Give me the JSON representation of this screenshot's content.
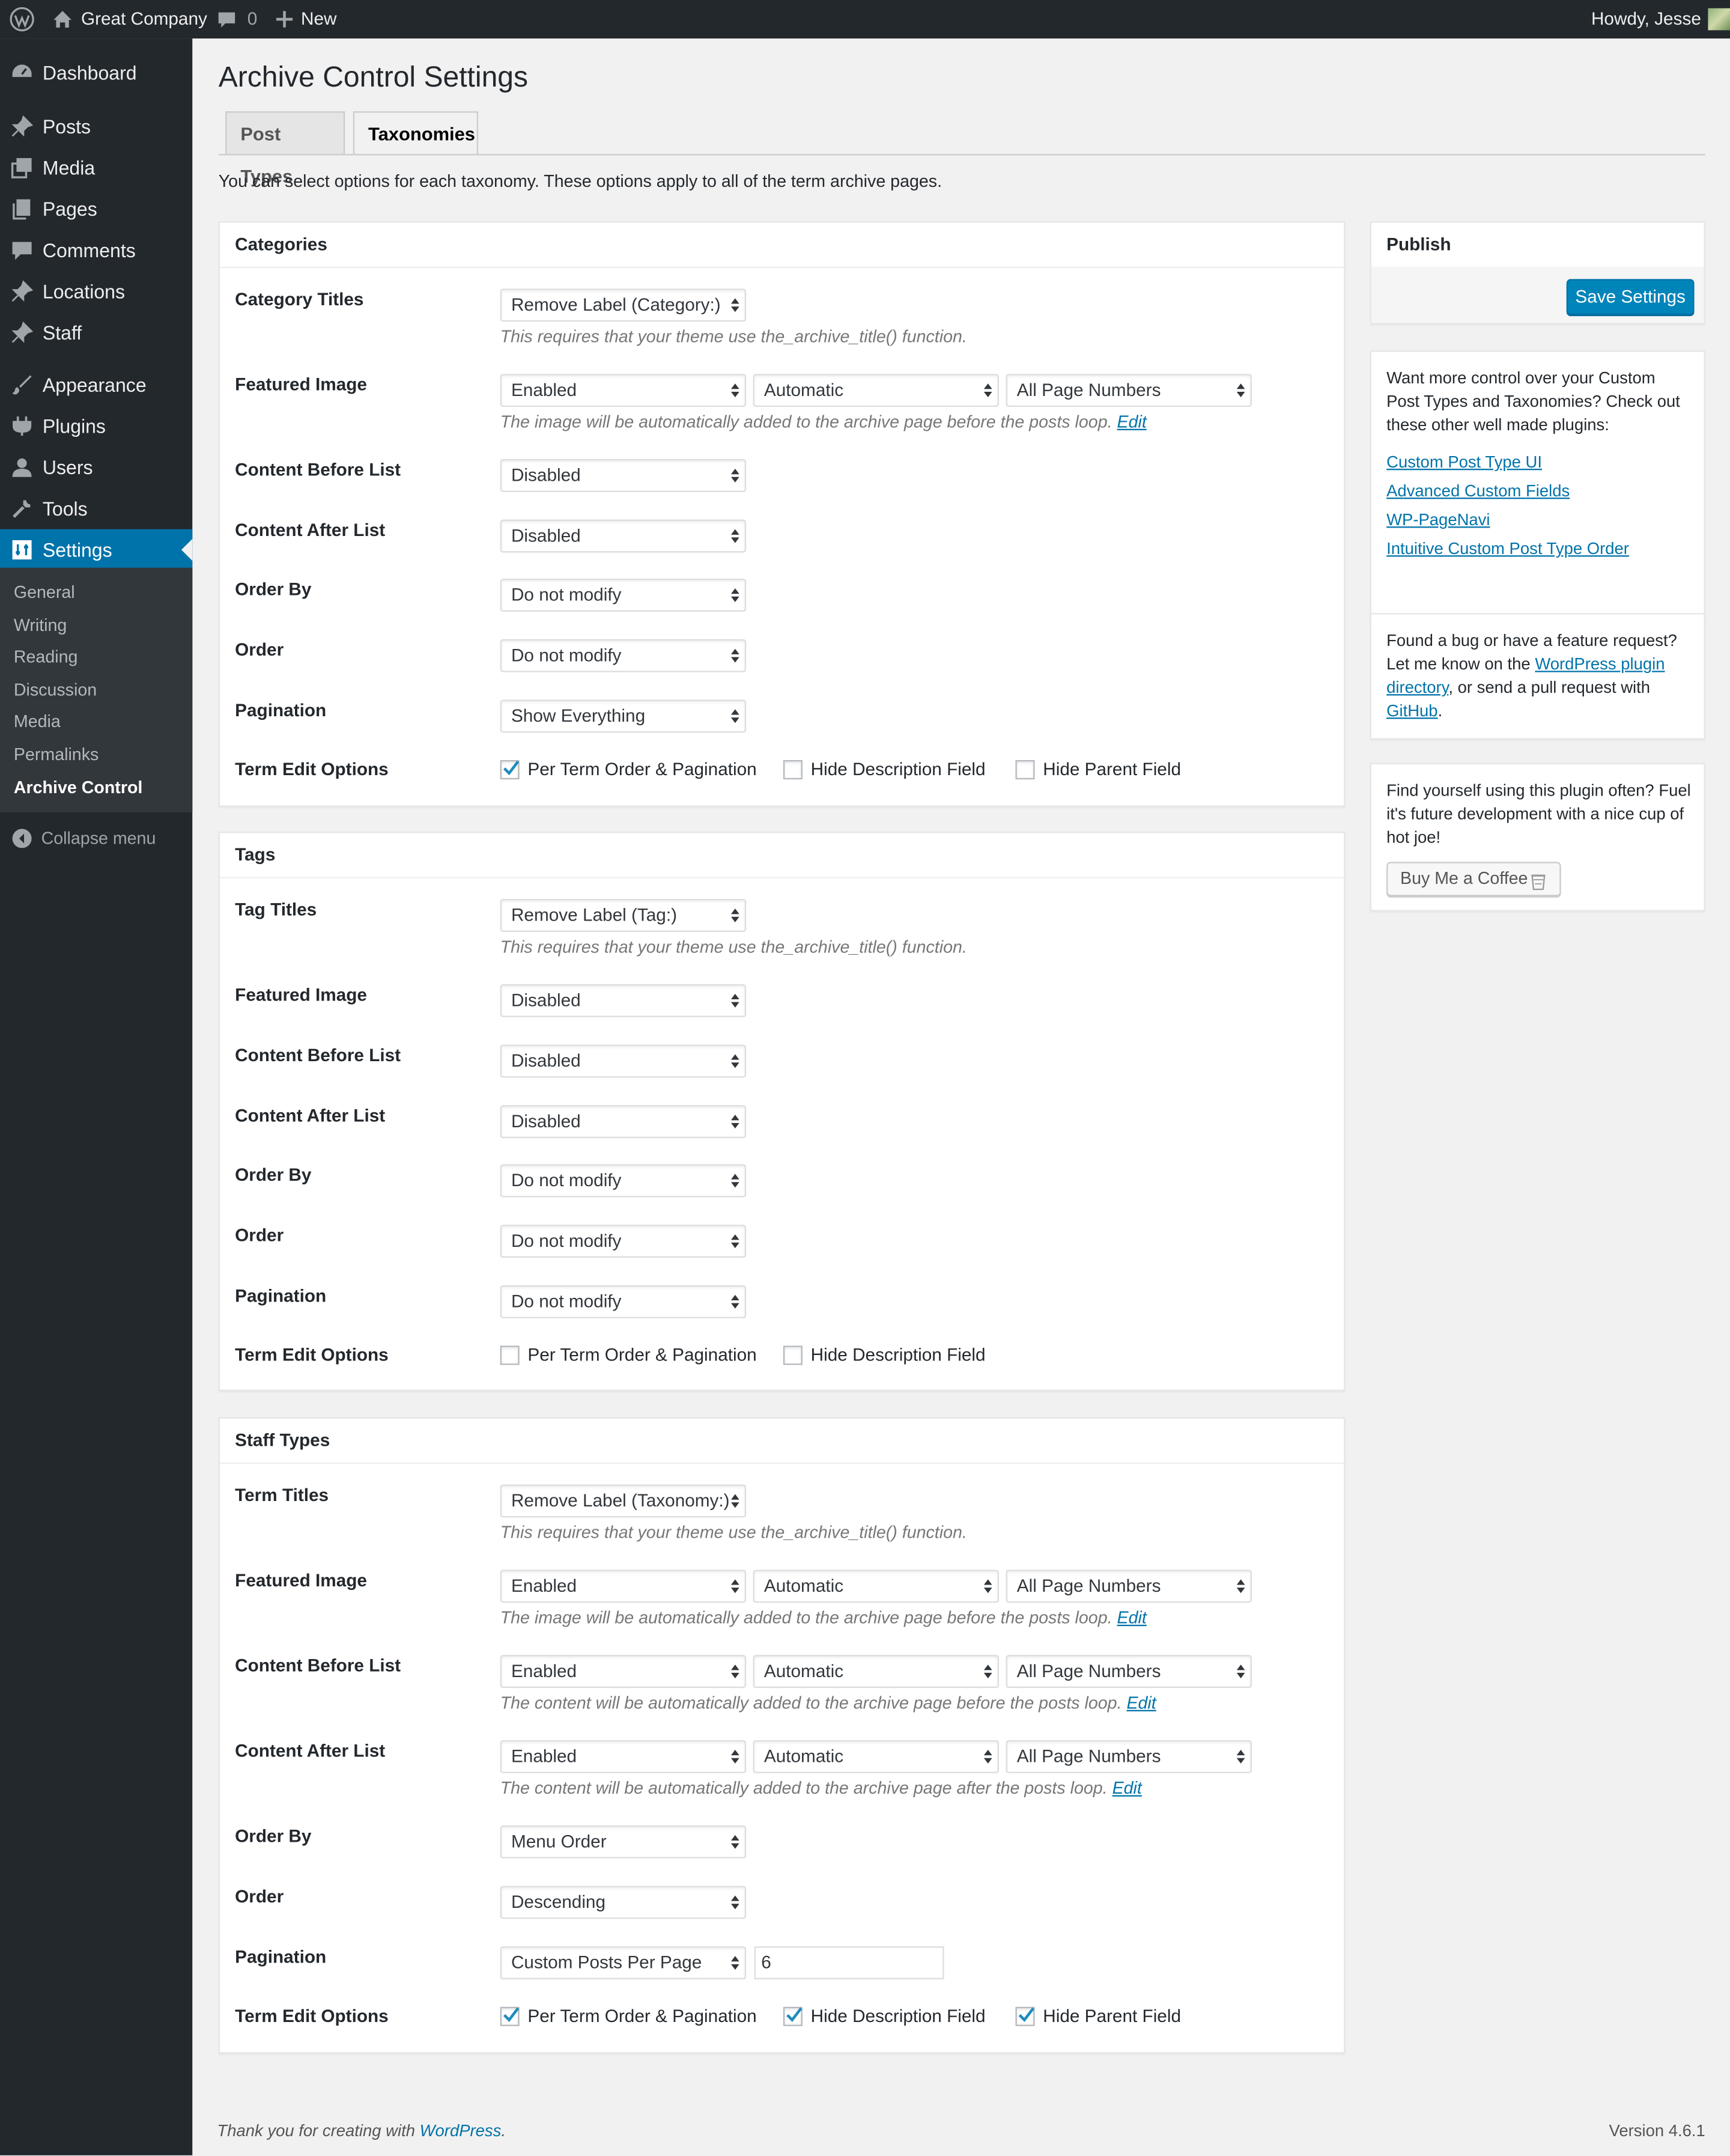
{
  "adminbar": {
    "site_name": "Great Company",
    "comments_count": "0",
    "new_label": "New",
    "howdy": "Howdy, Jesse"
  },
  "sidebar": {
    "items": [
      {
        "label": "Dashboard",
        "icon": "dashboard-icon"
      },
      {
        "label": "Posts",
        "icon": "pin-icon"
      },
      {
        "label": "Media",
        "icon": "media-icon"
      },
      {
        "label": "Pages",
        "icon": "pages-icon"
      },
      {
        "label": "Comments",
        "icon": "comments-icon"
      },
      {
        "label": "Locations",
        "icon": "pin-icon"
      },
      {
        "label": "Staff",
        "icon": "pin-icon"
      },
      {
        "label": "Appearance",
        "icon": "appearance-icon"
      },
      {
        "label": "Plugins",
        "icon": "plugins-icon"
      },
      {
        "label": "Users",
        "icon": "users-icon"
      },
      {
        "label": "Tools",
        "icon": "tools-icon"
      },
      {
        "label": "Settings",
        "icon": "settings-icon"
      }
    ],
    "submenu": [
      "General",
      "Writing",
      "Reading",
      "Discussion",
      "Media",
      "Permalinks",
      "Archive Control"
    ],
    "collapse": "Collapse menu"
  },
  "page": {
    "title": "Archive Control Settings",
    "tabs": [
      "Post Types",
      "Taxonomies"
    ],
    "intro": "You can select options for each taxonomy. These options apply to all of the term archive pages."
  },
  "labels": {
    "featured_image": "Featured Image",
    "content_before": "Content Before List",
    "content_after": "Content After List",
    "order_by": "Order By",
    "order": "Order",
    "pagination": "Pagination",
    "term_edit": "Term Edit Options",
    "per_term": "Per Term Order & Pagination",
    "hide_desc": "Hide Description Field",
    "hide_parent": "Hide Parent Field",
    "title_desc": "This requires that your theme use the_archive_title() function.",
    "img_desc": "The image will be automatically added to the archive page before the posts loop.",
    "before_desc": "The content will be automatically added to the archive page before the posts loop.",
    "after_desc": "The content will be automatically added to the archive page after the posts loop.",
    "edit": "Edit"
  },
  "categories": {
    "heading": "Categories",
    "titles_label": "Category Titles",
    "titles_value": "Remove Label (Category:)",
    "featured": [
      "Enabled",
      "Automatic",
      "All Page Numbers"
    ],
    "content_before": "Disabled",
    "content_after": "Disabled",
    "order_by": "Do not modify",
    "order": "Do not modify",
    "pagination": "Show Everything",
    "checks": [
      true,
      false,
      false
    ]
  },
  "tags": {
    "heading": "Tags",
    "titles_label": "Tag Titles",
    "titles_value": "Remove Label (Tag:)",
    "featured": "Disabled",
    "content_before": "Disabled",
    "content_after": "Disabled",
    "order_by": "Do not modify",
    "order": "Do not modify",
    "pagination": "Do not modify",
    "checks": [
      false,
      false
    ]
  },
  "staff": {
    "heading": "Staff Types",
    "titles_label": "Term Titles",
    "titles_value": "Remove Label (Taxonomy:)",
    "featured": [
      "Enabled",
      "Automatic",
      "All Page Numbers"
    ],
    "content_before": [
      "Enabled",
      "Automatic",
      "All Page Numbers"
    ],
    "content_after": [
      "Enabled",
      "Automatic",
      "All Page Numbers"
    ],
    "order_by": "Menu Order",
    "order": "Descending",
    "pagination": "Custom Posts Per Page",
    "per_page": "6",
    "checks": [
      true,
      true,
      true
    ]
  },
  "publish": {
    "heading": "Publish",
    "save": "Save Settings"
  },
  "promo": {
    "text": "Want more control over your Custom Post Types and Taxonomies? Check out these other well made plugins:",
    "links": [
      "Custom Post Type UI",
      "Advanced Custom Fields",
      "WP-PageNavi",
      "Intuitive Custom Post Type Order"
    ]
  },
  "bug": {
    "text1": "Found a bug or have a feature request? Let me know on the ",
    "link1": "WordPress plugin directory",
    "text2": ", or send a pull request with ",
    "link2": "GitHub",
    "text3": "."
  },
  "coffee": {
    "text": "Find yourself using this plugin often? Fuel it's future development with a nice cup of hot joe!",
    "button": "Buy Me a Coffee"
  },
  "footer": {
    "thanks": "Thank you for creating with ",
    "wp": "WordPress",
    "period": ".",
    "version": "Version 4.6.1"
  },
  "colors": {
    "admin_dark": "#23282d",
    "accent": "#0073aa",
    "button": "#0085ba",
    "background": "#f1f1f1"
  }
}
